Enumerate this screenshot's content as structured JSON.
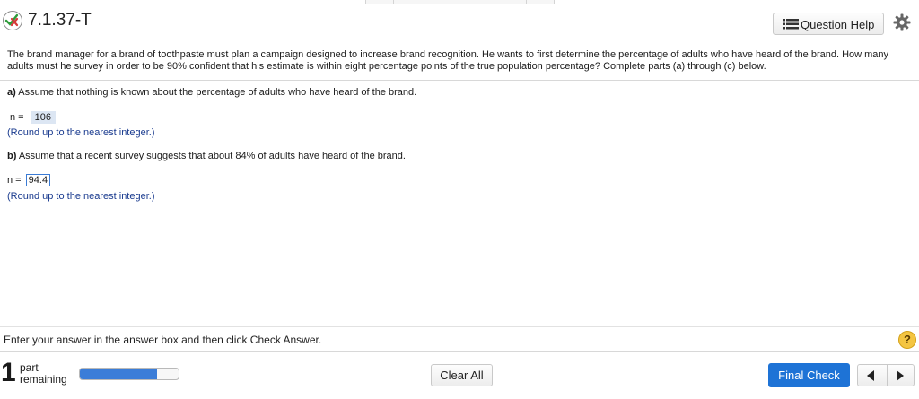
{
  "header": {
    "question_id": "7.1.37-T",
    "help_label": "Question Help",
    "icons": {
      "status": "partially-correct-icon",
      "help": "list-icon",
      "settings": "gear-icon"
    }
  },
  "question": {
    "intro": "The brand manager for a brand of toothpaste must plan a campaign designed to increase brand recognition. He wants to first determine the percentage of adults who have heard of the brand. How many adults must he survey in order to be 90% confident that his estimate is within eight percentage points of the true population percentage? Complete parts (a) through (c) below.",
    "part_a": {
      "marker": "a)",
      "text": "Assume that nothing is known about the percentage of adults who have heard of the brand.",
      "n_label": "n =",
      "answer": "106",
      "hint": "(Round up to the nearest integer.)"
    },
    "part_b": {
      "marker": "b)",
      "text": "Assume that a recent survey suggests that about 84% of adults have heard of the brand.",
      "n_label": "n =",
      "answer": "94.4",
      "hint": "(Round up to the nearest integer.)"
    }
  },
  "footer": {
    "instruction": "Enter your answer in the answer box and then click Check Answer.",
    "help_icon": "?",
    "parts_remaining_count": "1",
    "parts_remaining_word1": "part",
    "parts_remaining_word2": "remaining",
    "progress_fraction": 0.78,
    "clear_label": "Clear All",
    "final_label": "Final Check",
    "colors": {
      "accent": "#1e73d6",
      "progress": "#3b7dd8",
      "hint": "#1a3b8f"
    }
  }
}
